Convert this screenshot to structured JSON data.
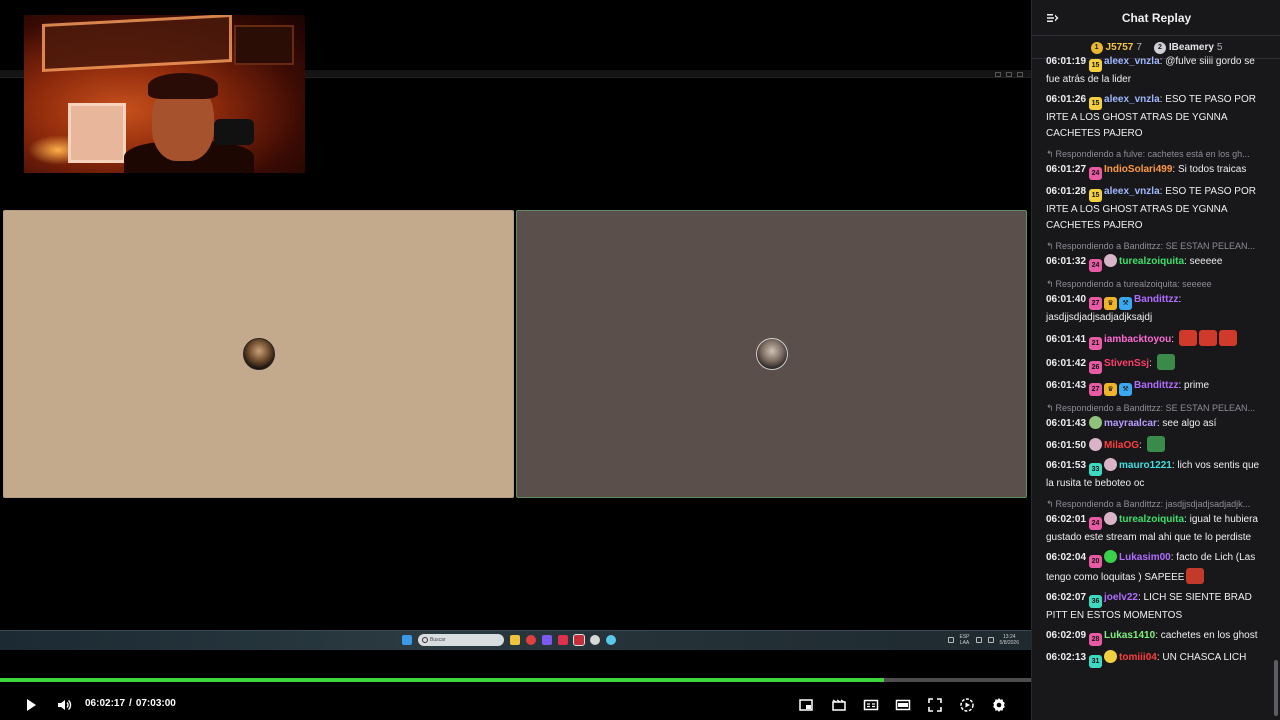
{
  "player": {
    "current_time": "06:02:17",
    "separator": "/",
    "total_time": "07:03:00",
    "progress_fraction": 0.857,
    "buffer_fraction": 0.0,
    "progress_color": "#3fd43c"
  },
  "taskbar": {
    "search_placeholder": "Buscar",
    "lang_top": "ESP",
    "lang_bottom": "LAA",
    "clock_time": "13:24",
    "clock_date": "5/8/2026"
  },
  "chat": {
    "title": "Chat Replay",
    "leaderboard": [
      {
        "rank": "1",
        "name": "J5757",
        "score": "7",
        "color": "#f6c443",
        "rank_color": "#e8b930"
      },
      {
        "rank": "2",
        "name": "IBeamery",
        "score": "5",
        "color": "#e4e4ea",
        "rank_color": "#cfcfd6"
      }
    ],
    "messages": [
      {
        "reply": "",
        "ts": "06:01:19",
        "badges": [
          {
            "label": "15",
            "color": "#f4d03f"
          }
        ],
        "user": "aleex_vnzla",
        "color": "#9fb8ff",
        "text": "@fulve siiii gordo se fue atrás de la lider",
        "emotes": []
      },
      {
        "reply": "",
        "ts": "06:01:26",
        "badges": [
          {
            "label": "15",
            "color": "#f4d03f"
          }
        ],
        "user": "aleex_vnzla",
        "color": "#9fb8ff",
        "text": "ESO TE PASO POR IRTE A LOS GHOST ATRAS DE YGNNA CACHETES PAJERO",
        "emotes": []
      },
      {
        "reply": "Respondiendo a fulve: cachetes está en los gh...",
        "ts": "06:01:27",
        "badges": [
          {
            "label": "24",
            "color": "#e85aa4"
          }
        ],
        "user": "IndioSolari499",
        "color": "#ff9a3c",
        "text": "Si todos traicas",
        "emotes": []
      },
      {
        "reply": "",
        "ts": "06:01:28",
        "badges": [
          {
            "label": "15",
            "color": "#f4d03f"
          }
        ],
        "user": "aleex_vnzla",
        "color": "#9fb8ff",
        "text": "ESO TE PASO POR IRTE A LOS GHOST ATRAS DE YGNNA CACHETES PAJERO",
        "emotes": []
      },
      {
        "reply": "Respondiendo a Bandittzz: SE ESTAN PELEAN...",
        "ts": "06:01:32",
        "badges": [
          {
            "label": "24",
            "color": "#e85aa4"
          },
          {
            "label": "",
            "color": "#d9b4c8"
          }
        ],
        "user": "turealzoiquita",
        "color": "#3be06a",
        "text": "seeeee",
        "emotes": []
      },
      {
        "reply": "Respondiendo a turealzoiquita: seeeee",
        "ts": "06:01:40",
        "badges": [
          {
            "label": "27",
            "color": "#e85aa4"
          },
          {
            "label": "♛",
            "color": "#f0b428"
          },
          {
            "label": "⚒",
            "color": "#3aa8f0"
          }
        ],
        "user": "Bandittzz",
        "color": "#b06cff",
        "text": "jasdjjsdjadjsadjadjksajdj",
        "emotes": []
      },
      {
        "reply": "",
        "ts": "06:01:41",
        "badges": [
          {
            "label": "21",
            "color": "#e85aa4"
          }
        ],
        "user": "iambacktoyou",
        "color": "#ff6ad5",
        "text": "",
        "emotes": [
          "#d03a2a",
          "#d03a2a",
          "#d03a2a"
        ]
      },
      {
        "reply": "",
        "ts": "06:01:42",
        "badges": [
          {
            "label": "26",
            "color": "#e85aa4"
          }
        ],
        "user": "StivenSsj",
        "color": "#ff3d6a",
        "text": "",
        "emotes": [
          "#3a8a4a"
        ]
      },
      {
        "reply": "",
        "ts": "06:01:43",
        "badges": [
          {
            "label": "27",
            "color": "#e85aa4"
          },
          {
            "label": "♛",
            "color": "#f0b428"
          },
          {
            "label": "⚒",
            "color": "#3aa8f0"
          }
        ],
        "user": "Bandittzz",
        "color": "#b06cff",
        "text": "prime",
        "emotes": []
      },
      {
        "reply": "Respondiendo a Bandittzz: SE ESTAN PELEAN...",
        "ts": "06:01:43",
        "badges": [
          {
            "label": "",
            "color": "#8fc27a"
          }
        ],
        "user": "mayraalcar",
        "color": "#b79cff",
        "text": "see algo así",
        "emotes": []
      },
      {
        "reply": "",
        "ts": "06:01:50",
        "badges": [
          {
            "label": "",
            "color": "#d9b4c8"
          }
        ],
        "user": "MilaOG",
        "color": "#ff3d3d",
        "text": "",
        "emotes": [
          "#3a8a4a"
        ]
      },
      {
        "reply": "",
        "ts": "06:01:53",
        "badges": [
          {
            "label": "33",
            "color": "#3fd8c0"
          },
          {
            "label": "",
            "color": "#d9b4c8"
          }
        ],
        "user": "mauro1221",
        "color": "#3be0e0",
        "text": "lich vos sentis que la rusita te beboteo oc",
        "emotes": []
      },
      {
        "reply": "Respondiendo a Bandittzz: jasdjjsdjadjsadjadjk...",
        "ts": "06:02:01",
        "badges": [
          {
            "label": "24",
            "color": "#e85aa4"
          },
          {
            "label": "",
            "color": "#d9b4c8"
          }
        ],
        "user": "turealzoiquita",
        "color": "#3be06a",
        "text": "igual te hubiera gustado este stream mal ahi que te lo perdiste",
        "emotes": []
      },
      {
        "reply": "",
        "ts": "06:02:04",
        "badges": [
          {
            "label": "20",
            "color": "#e85aa4"
          },
          {
            "label": "",
            "color": "#3bd04a"
          }
        ],
        "user": "Lukasim00",
        "color": "#b06cff",
        "text": "facto de Lich (Las tengo como loquitas ) SAPEEE",
        "emotes": [
          "#c23a2a"
        ]
      },
      {
        "reply": "",
        "ts": "06:02:07",
        "badges": [
          {
            "label": "36",
            "color": "#3fd8c0"
          }
        ],
        "user": "joelv22",
        "color": "#b06cff",
        "text": "LICH SE SIENTE BRAD PITT EN ESTOS MOMENTOS",
        "emotes": []
      },
      {
        "reply": "",
        "ts": "06:02:09",
        "badges": [
          {
            "label": "28",
            "color": "#e85aa4"
          }
        ],
        "user": "Lukas1410",
        "color": "#7ef07a",
        "text": "cachetes en los ghost",
        "emotes": []
      },
      {
        "reply": "",
        "ts": "06:02:13",
        "badges": [
          {
            "label": "31",
            "color": "#3fd8c0"
          },
          {
            "label": "",
            "color": "#f0d040"
          }
        ],
        "user": "tomiii04",
        "color": "#ff3d3d",
        "text": "UN CHASCA LICH",
        "emotes": []
      }
    ]
  }
}
